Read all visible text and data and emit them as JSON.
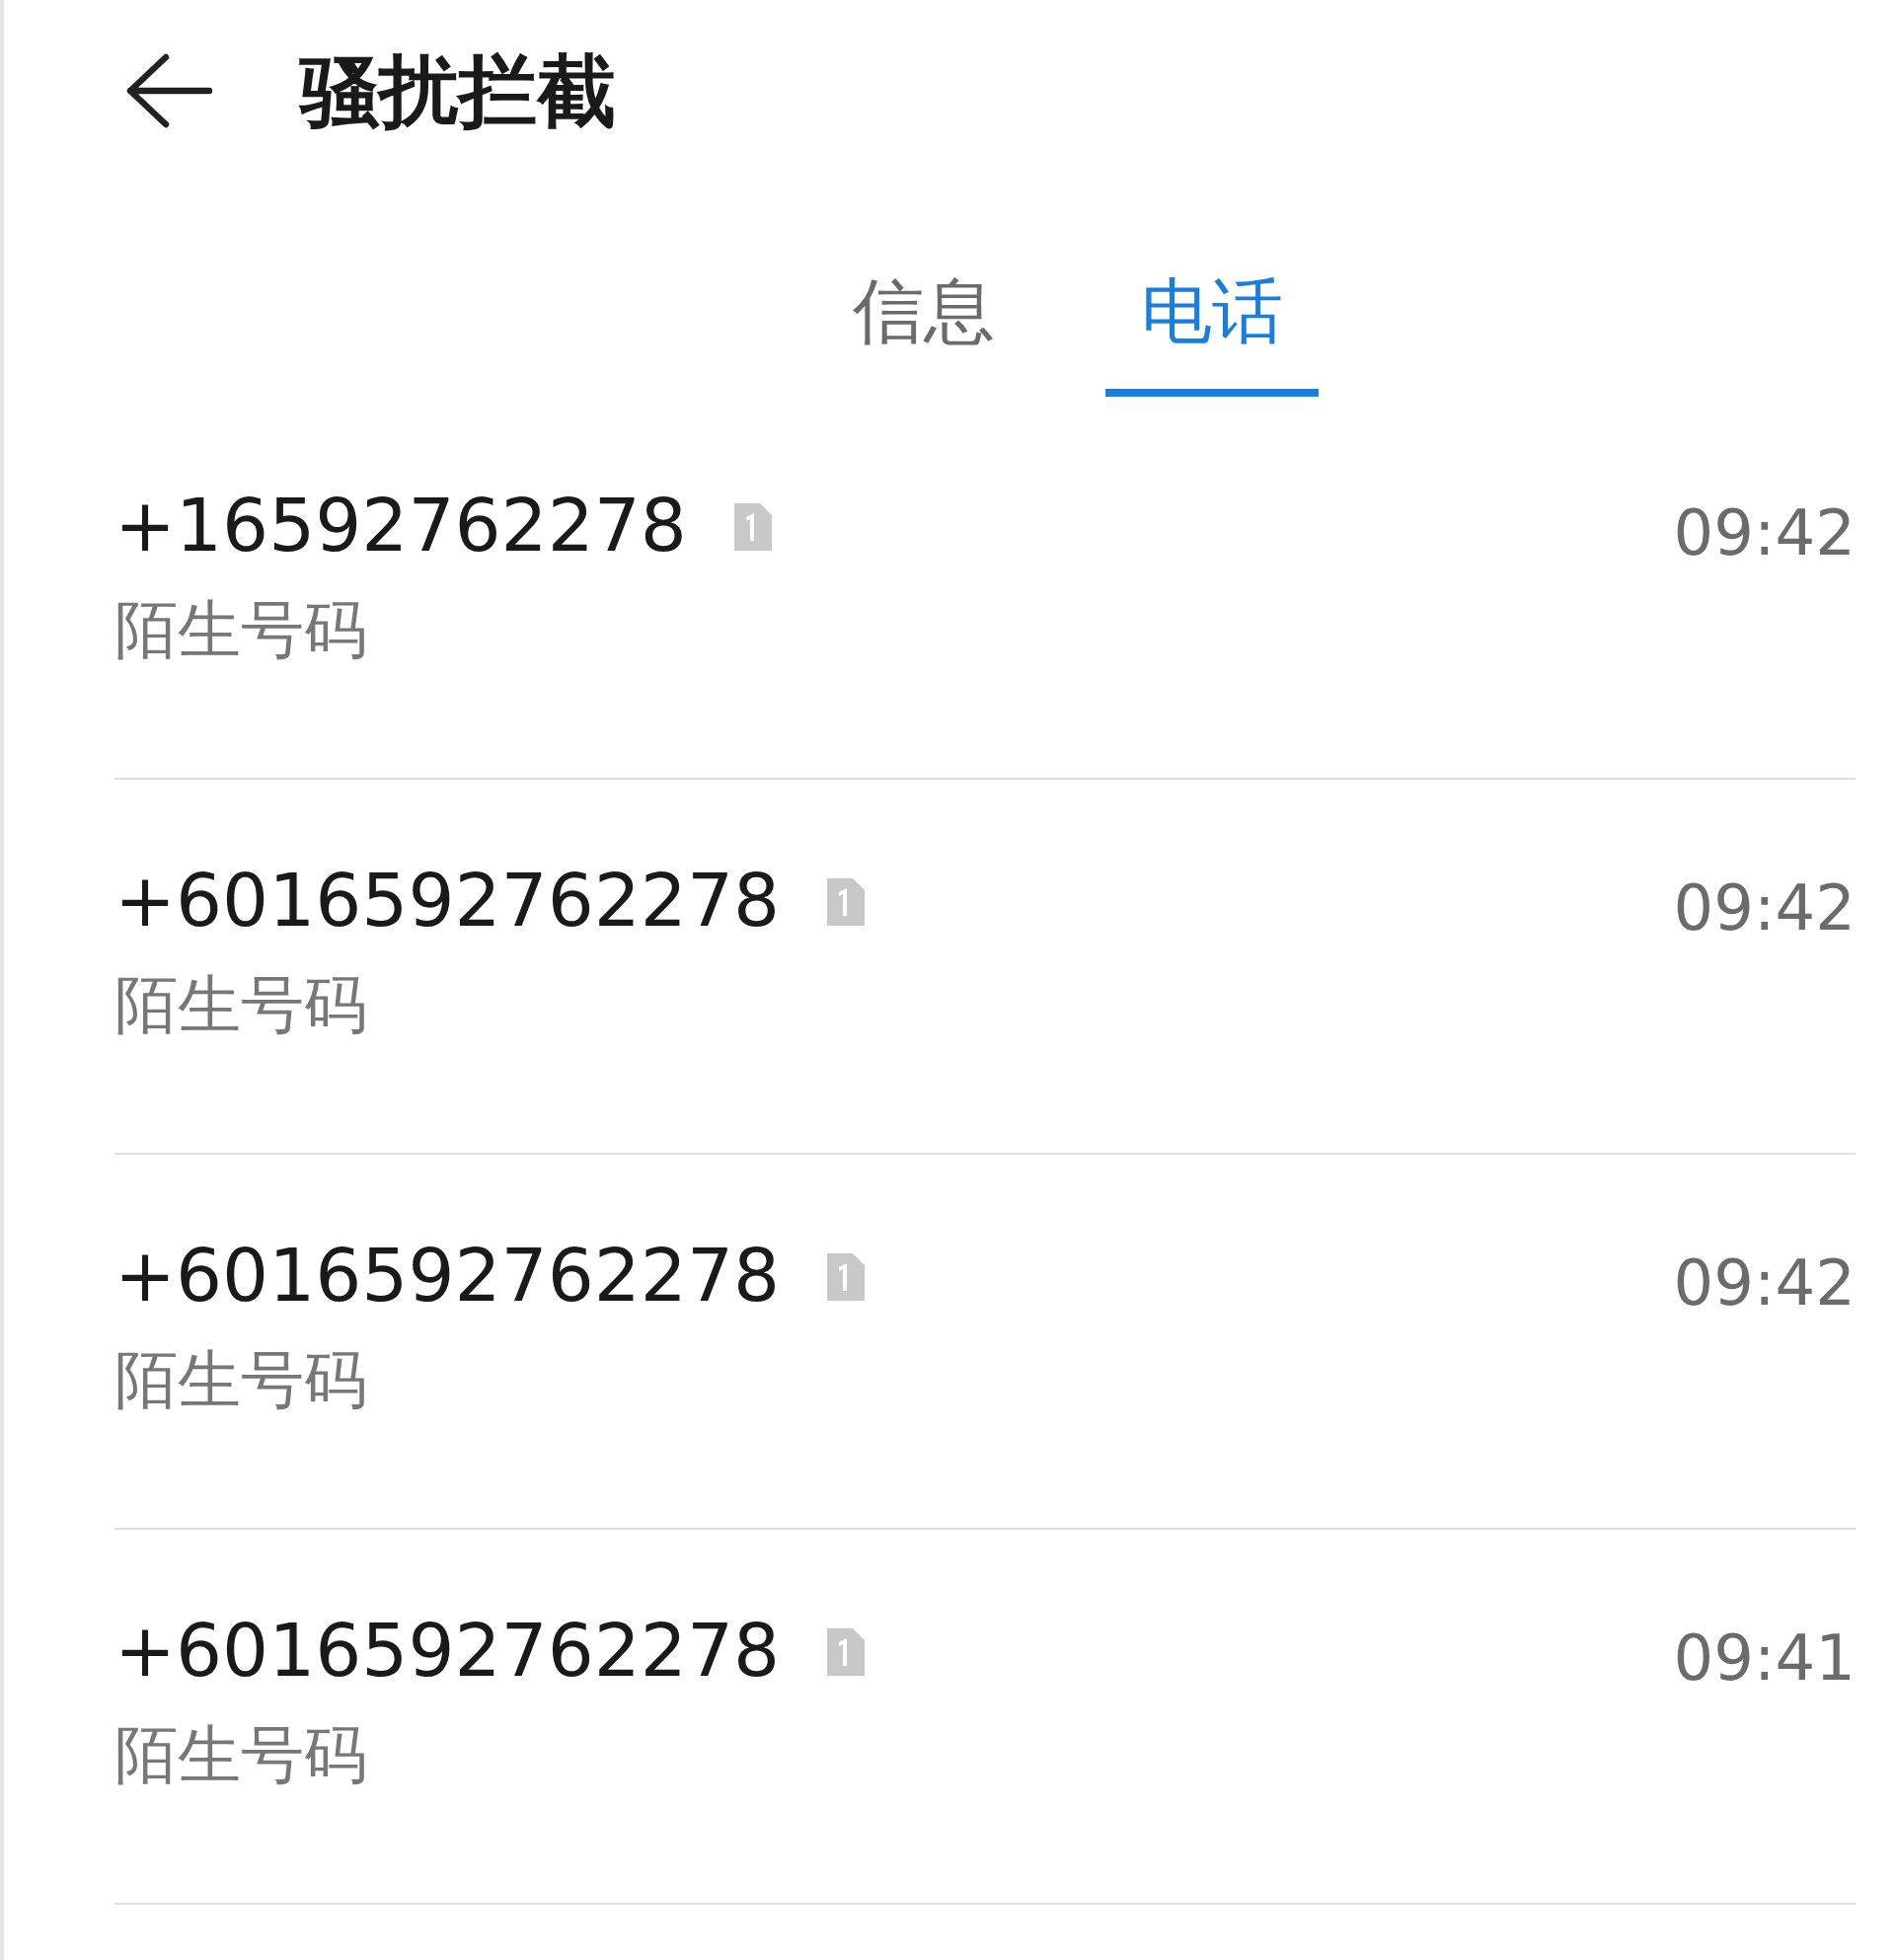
{
  "header": {
    "title": "骚扰拦截"
  },
  "tabs": [
    {
      "label": "信息",
      "selected": false
    },
    {
      "label": "电话",
      "selected": true
    }
  ],
  "calls": [
    {
      "number": "+16592762278",
      "label": "陌生号码",
      "time": "09:42"
    },
    {
      "number": "+6016592762278",
      "label": "陌生号码",
      "time": "09:42"
    },
    {
      "number": "+6016592762278",
      "label": "陌生号码",
      "time": "09:42"
    },
    {
      "number": "+6016592762278",
      "label": "陌生号码",
      "time": "09:41"
    }
  ]
}
